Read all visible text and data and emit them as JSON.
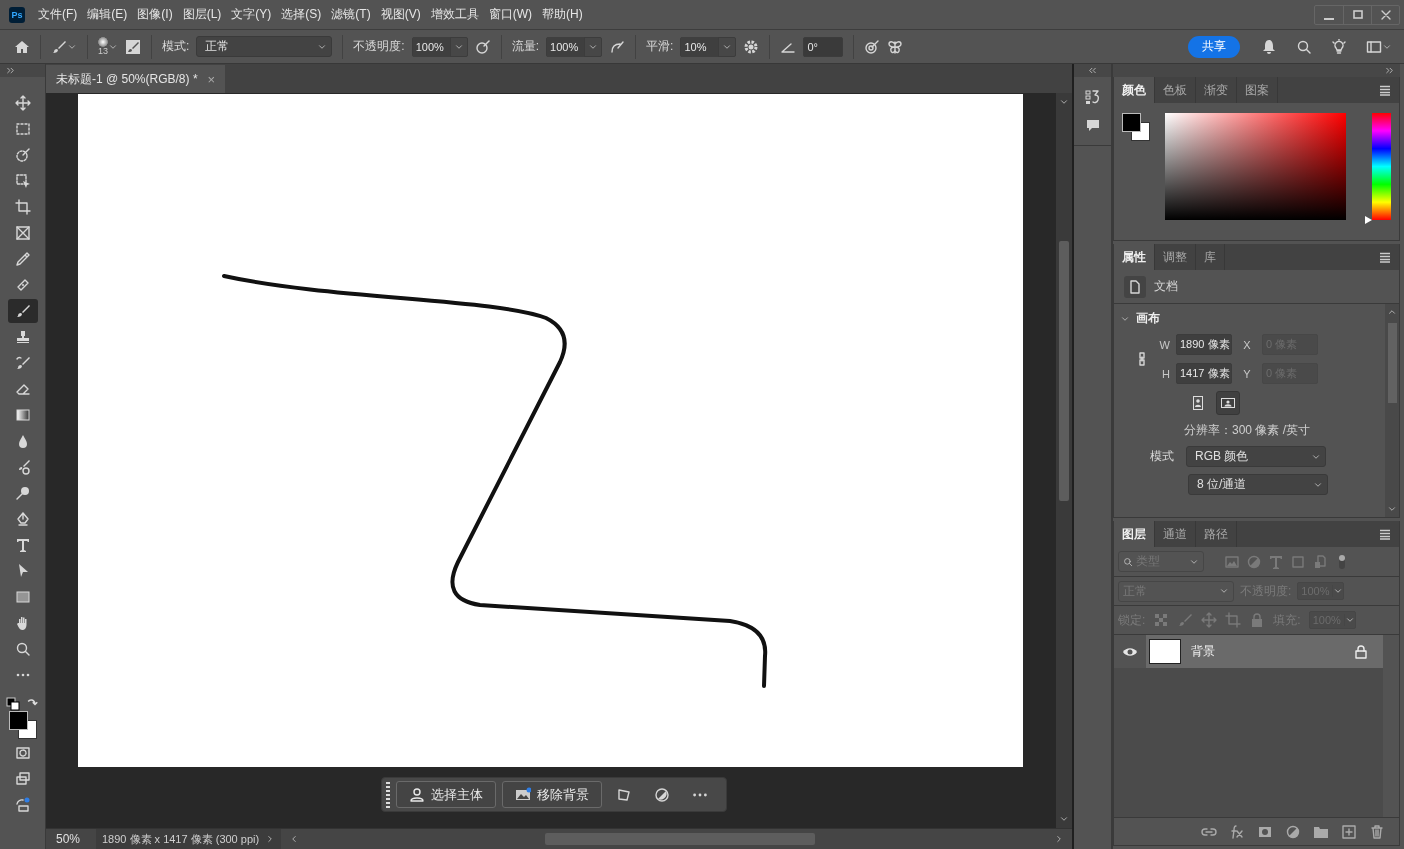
{
  "app_logo": "Ps",
  "menu": [
    "文件(F)",
    "编辑(E)",
    "图像(I)",
    "图层(L)",
    "文字(Y)",
    "选择(S)",
    "滤镜(T)",
    "视图(V)",
    "增效工具",
    "窗口(W)",
    "帮助(H)"
  ],
  "options_bar": {
    "brush_size": "13",
    "mode_label": "模式:",
    "mode_value": "正常",
    "opacity_label": "不透明度:",
    "opacity_value": "100%",
    "flow_label": "流量:",
    "flow_value": "100%",
    "smoothing_label": "平滑:",
    "smoothing_value": "10%",
    "angle_value": "0°",
    "share_button": "共享"
  },
  "document_tab": {
    "title": "未标题-1 @ 50%(RGB/8) *",
    "close": "×"
  },
  "tools": [
    {
      "kind": "move",
      "selected": false
    },
    {
      "kind": "marquee",
      "selected": false
    },
    {
      "kind": "quick_select",
      "selected": false
    },
    {
      "kind": "object_select",
      "selected": false
    },
    {
      "kind": "crop",
      "selected": false
    },
    {
      "kind": "frame",
      "selected": false
    },
    {
      "kind": "eyedropper",
      "selected": false
    },
    {
      "kind": "healing",
      "selected": false
    },
    {
      "kind": "brush",
      "selected": true
    },
    {
      "kind": "stamp",
      "selected": false
    },
    {
      "kind": "history_brush",
      "selected": false
    },
    {
      "kind": "eraser",
      "selected": false
    },
    {
      "kind": "gradient",
      "selected": false
    },
    {
      "kind": "blur",
      "selected": false
    },
    {
      "kind": "mixer",
      "selected": false
    },
    {
      "kind": "dodge",
      "selected": false
    },
    {
      "kind": "pen",
      "selected": false
    },
    {
      "kind": "type",
      "selected": false
    },
    {
      "kind": "path_select",
      "selected": false
    },
    {
      "kind": "rectangle",
      "selected": false
    },
    {
      "kind": "hand",
      "selected": false
    },
    {
      "kind": "zoom",
      "selected": false
    },
    {
      "kind": "more",
      "selected": false
    }
  ],
  "taskbar": {
    "buttons": [
      "选择主体",
      "移除背景"
    ]
  },
  "status_bar": {
    "zoom": "50%",
    "info": "1890 像素 x 1417 像素 (300 ppi)"
  },
  "color_panel": {
    "hue_slider": {
      "level": 0
    },
    "tabs": [
      {
        "label": "颜色",
        "selected": true
      },
      {
        "label": "色板",
        "selected": false
      },
      {
        "label": "渐变",
        "selected": false
      },
      {
        "label": "图案",
        "selected": false
      }
    ]
  },
  "properties_panel": {
    "tabs": [
      {
        "label": "属性",
        "selected": true
      },
      {
        "label": "调整",
        "selected": false
      },
      {
        "label": "库",
        "selected": false
      }
    ],
    "doc_label": "文档",
    "section_title": "画布",
    "section_expanded": true,
    "w_label": "W",
    "w_value": "1890 像素",
    "h_label": "H",
    "h_value": "1417 像素",
    "x_label": "X",
    "x_value": "0 像素",
    "x_disabled": true,
    "y_label": "Y",
    "y_value": "0 像素",
    "y_disabled": true,
    "orientation": [
      {
        "kind": "portrait",
        "selected": false
      },
      {
        "kind": "landscape",
        "selected": true
      }
    ],
    "resolution": "分辨率：300 像素 /英寸",
    "mode_label": "模式",
    "mode_value": "RGB 颜色",
    "depth_value": "8 位/通道"
  },
  "layers_panel": {
    "tabs": [
      {
        "label": "图层",
        "selected": true
      },
      {
        "label": "通道",
        "selected": false
      },
      {
        "label": "路径",
        "selected": false
      }
    ],
    "filter_placeholder": "类型",
    "blend_mode": "正常",
    "opacity_label": "不透明度:",
    "opacity_value": "100%",
    "lock_label": "锁定:",
    "fill_label": "填充:",
    "fill_value": "100%",
    "layers": [
      {
        "name": "背景",
        "visible": true,
        "selected": true,
        "locked": true
      }
    ]
  }
}
